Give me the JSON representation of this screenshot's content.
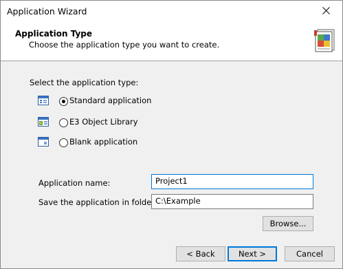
{
  "window": {
    "title": "Application Wizard"
  },
  "header": {
    "title": "Application Type",
    "subtitle": "Choose the application type you want to create."
  },
  "app_type": {
    "label": "Select the application type:",
    "options": [
      {
        "label": "Standard application",
        "icon": "standard-app-icon",
        "selected": true
      },
      {
        "label": "E3 Object Library",
        "icon": "object-library-icon",
        "selected": false
      },
      {
        "label": "Blank application",
        "icon": "blank-app-icon",
        "selected": false
      }
    ]
  },
  "form": {
    "name_label": "Application name:",
    "name_value": "Project1",
    "folder_label": "Save the application in folder:",
    "folder_value": "C:\\Example",
    "browse_label": "Browse..."
  },
  "buttons": {
    "back": "< Back",
    "next": "Next >",
    "cancel": "Cancel"
  },
  "colors": {
    "accent": "#0078d7",
    "header_bg": "#ffffff",
    "dialog_bg": "#f0f0f0"
  }
}
